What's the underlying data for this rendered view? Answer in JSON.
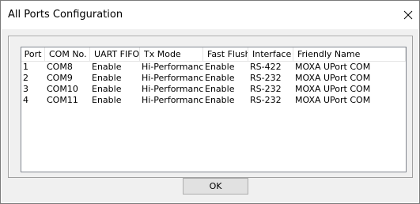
{
  "window": {
    "title": "All Ports Configuration",
    "close_icon": "close-icon"
  },
  "table": {
    "columns": [
      "Port",
      "COM No.",
      "UART FIFO",
      "Tx Mode",
      "Fast Flush",
      "Interface",
      "Friendly Name"
    ],
    "rows": [
      [
        "1",
        "COM8",
        "Enable",
        "Hi-Performance",
        "Enable",
        "RS-422",
        "MOXA UPort COM"
      ],
      [
        "2",
        "COM9",
        "Enable",
        "Hi-Performance",
        "Enable",
        "RS-232",
        "MOXA UPort COM"
      ],
      [
        "3",
        "COM10",
        "Enable",
        "Hi-Performance",
        "Enable",
        "RS-232",
        "MOXA UPort COM"
      ],
      [
        "4",
        "COM11",
        "Enable",
        "Hi-Performance",
        "Enable",
        "RS-232",
        "MOXA UPort COM"
      ]
    ]
  },
  "buttons": {
    "ok_label": "OK"
  }
}
